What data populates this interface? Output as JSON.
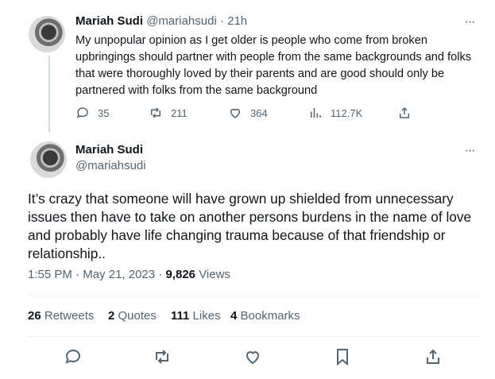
{
  "tweet1": {
    "author_name": "Mariah Sudi",
    "handle": "@mariahsudi",
    "separator": "·",
    "time": "21h",
    "text": "My unpopular opinion as I get older is people who come from broken upbringings should partner with people from the same backgrounds and folks that were thoroughly loved by their parents and are good should only be partnered with folks from the same background",
    "replies": "35",
    "retweets": "211",
    "likes": "364",
    "views": "112.7K"
  },
  "tweet2": {
    "author_name": "Mariah Sudi",
    "handle": "@mariahsudi",
    "text": "It’s crazy that someone will have grown up shielded from unnecessary issues then have to take on another persons burdens in the name of love and probably have life changing trauma because of that friendship or relationship..",
    "time": "1:55 PM",
    "date": "May 21, 2023",
    "meta_separator": "·",
    "views_count": "9,826",
    "views_label": "Views",
    "stats": {
      "retweets_count": "26",
      "retweets_label": "Retweets",
      "quotes_count": "2",
      "quotes_label": "Quotes",
      "likes_count": "111",
      "likes_label": "Likes",
      "bookmarks_count": "4",
      "bookmarks_label": "Bookmarks"
    }
  },
  "more_glyph": "···",
  "colors": {
    "text": "#0f1419",
    "muted": "#536471",
    "divider": "#eff3f4",
    "thread_line": "#cfd9de"
  },
  "icons": [
    "reply-icon",
    "retweet-icon",
    "like-icon",
    "views-icon",
    "share-icon",
    "bookmark-icon",
    "more-icon"
  ]
}
